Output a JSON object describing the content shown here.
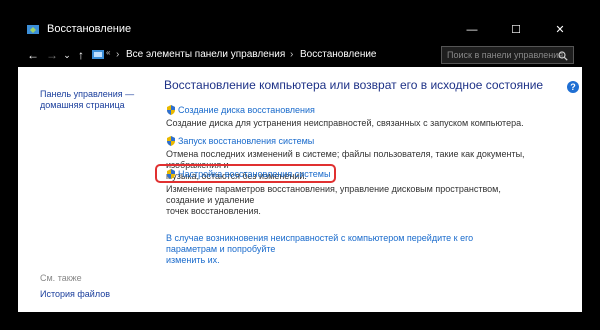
{
  "window": {
    "title": "Восстановление",
    "minimize": "—",
    "maximize": "☐",
    "close": "✕"
  },
  "nav": {
    "back": "←",
    "forward": "→",
    "dropdown": "⌄",
    "up": "↑"
  },
  "address": {
    "overflow": "«",
    "crumbs": [
      "Все элементы панели управления",
      "Восстановление"
    ],
    "separator": "›"
  },
  "search": {
    "placeholder": "Поиск в панели управления"
  },
  "sidebar": {
    "home_link": [
      "Панель управления —",
      "домашняя страница"
    ],
    "see_also": "См. также",
    "file_history": "История файлов"
  },
  "main": {
    "heading": "Восстановление компьютера или возврат его в исходное состояние",
    "items": [
      {
        "link": "Создание диска восстановления",
        "desc": [
          "Создание диска для устранения неисправностей, связанных с запуском компьютера."
        ]
      },
      {
        "link": "Запуск восстановления системы",
        "desc": [
          "Отмена последних изменений в системе; файлы пользователя, такие как документы, изображения и",
          "музыка, остаются без изменений."
        ]
      },
      {
        "link": "Настройка восстановления системы",
        "desc": [
          "Изменение параметров восстановления, управление дисковым пространством, создание и удаление",
          "точек восстановления."
        ]
      }
    ],
    "bottom_link": [
      "В случае возникновения неисправностей с компьютером перейдите к его параметрам и попробуйте",
      "изменить их."
    ],
    "help": "?"
  },
  "colors": {
    "accent": "#1a6bcc",
    "heading": "#1e3287",
    "highlight": "#e03030"
  }
}
